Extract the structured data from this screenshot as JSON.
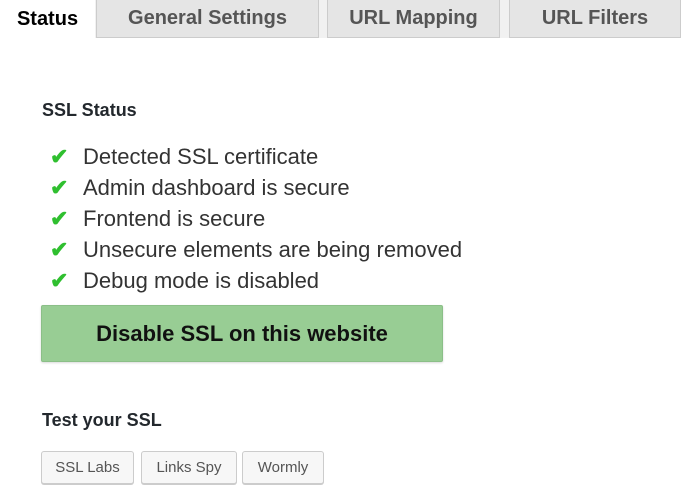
{
  "tabs": [
    {
      "label": "Status",
      "active": true
    },
    {
      "label": "General Settings"
    },
    {
      "label": "URL Mapping"
    },
    {
      "label": "URL Filters"
    }
  ],
  "ssl_status": {
    "heading": "SSL Status",
    "items": [
      "Detected SSL certificate",
      "Admin dashboard is secure",
      "Frontend is secure",
      "Unsecure elements are being removed",
      "Debug mode is disabled"
    ],
    "check_color": "#2fbf2f"
  },
  "disable_button": {
    "label": "Disable SSL on this website",
    "color": "#98cd94"
  },
  "test": {
    "heading": "Test your SSL",
    "buttons": [
      "SSL Labs",
      "Links Spy",
      "Wormly"
    ]
  }
}
